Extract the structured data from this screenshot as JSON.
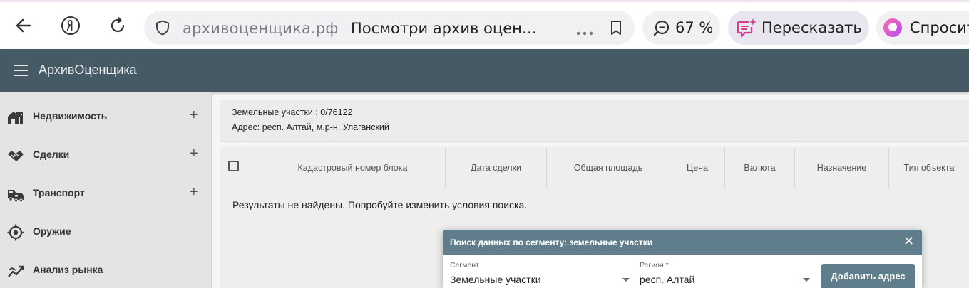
{
  "browser": {
    "domain": "архивоценщика.рф",
    "page_title": "Посмотри архив оцен…",
    "zoom": "67 %",
    "retell_label": "Пересказать",
    "ask_label": "Спросит"
  },
  "app": {
    "title": "АрхивОценщика"
  },
  "sidebar": {
    "items": [
      {
        "label": "Недвижимость",
        "icon": "house-icon",
        "expandable": true
      },
      {
        "label": "Сделки",
        "icon": "handshake-icon",
        "expandable": true
      },
      {
        "label": "Транспорт",
        "icon": "car-icon",
        "expandable": true
      },
      {
        "label": "Оружие",
        "icon": "target-icon",
        "expandable": false
      },
      {
        "label": "Анализ рынка",
        "icon": "chart-icon",
        "expandable": false
      }
    ],
    "plus": "+"
  },
  "info": {
    "line1": "Земельные участки : 0/76122",
    "line2": "Адрес: респ. Алтай, м.р-н. Улаганский"
  },
  "table": {
    "columns": [
      "Кадастровый номер блока",
      "Дата сделки",
      "Общая площадь",
      "Цена",
      "Валюта",
      "Назначение",
      "Тип объекта"
    ],
    "empty_message": "Результаты не найдены. Попробуйте изменить условия поиска."
  },
  "dialog": {
    "title": "Поиск данных по сегменту: земельные участки",
    "close": "✕",
    "segment_label": "Сегмент",
    "segment_value": "Земельные участки",
    "region_label": "Регион *",
    "region_value": "респ. Алтай",
    "add_button": "Добавить адрес"
  },
  "colors": {
    "appbar": "#455a64",
    "dialog_header": "#607d8b",
    "sidebar": "#e4e4e4"
  }
}
